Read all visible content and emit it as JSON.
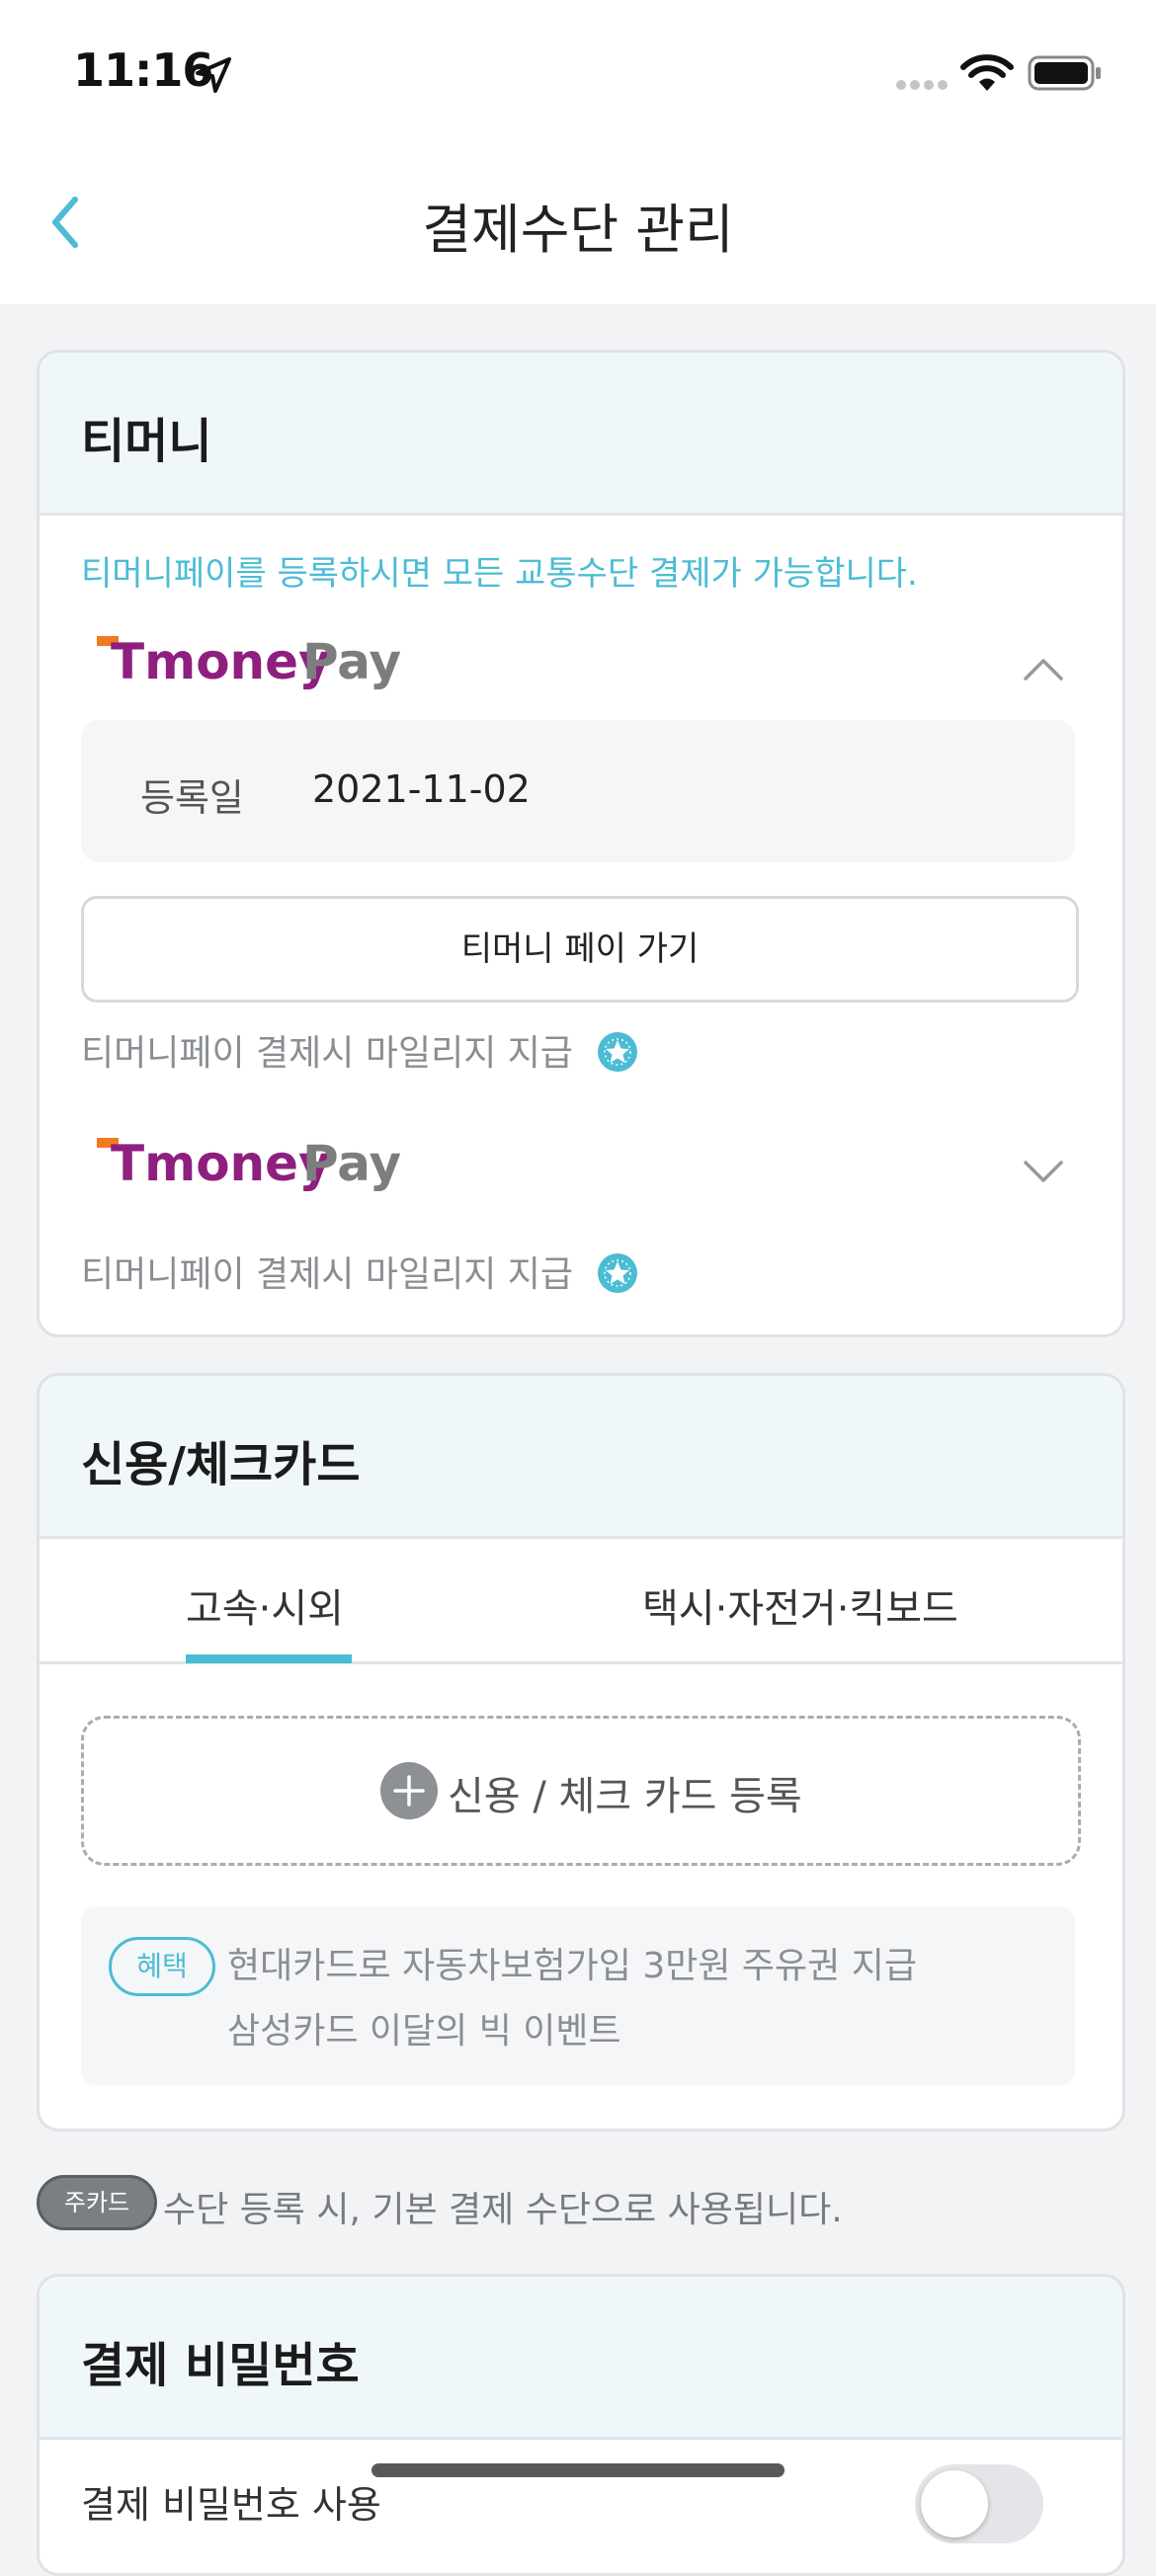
{
  "status_bar": {
    "time": "11:16",
    "icons": [
      "location-arrow-icon",
      "signal-dots-icon",
      "wifi-icon",
      "battery-icon"
    ]
  },
  "nav": {
    "title": "결제수단 관리",
    "back_icon": "chevron-left-icon"
  },
  "colors": {
    "accent": "#4bbcd4",
    "tmoney_purple": "#8e1f7e",
    "tmoney_orange": "#f07a1f",
    "tmoney_gray": "#7d7d7d"
  },
  "tmoney": {
    "title": "티머니",
    "info": "티머니페이를 등록하시면 모든 교통수단 결제가 가능합니다.",
    "logo_text_1": "Tmoney",
    "logo_text_2": "Pay",
    "registered_label": "등록일",
    "registered_date": "2021-11-02",
    "go_button": "티머니 페이 가기",
    "mileage_text_1": "티머니페이 결제시 마일리지 지급",
    "mileage_text_2": "티머니페이 결제시 마일리지 지급"
  },
  "credit": {
    "title": "신용/체크카드",
    "tabs": [
      {
        "label": "고속·시외",
        "selected": true
      },
      {
        "label": "택시·자전거·킥보드",
        "selected": false
      }
    ],
    "add_label": "신용 / 체크 카드 등록",
    "benefit_badge": "혜택",
    "benefits": [
      "현대카드로 자동차보험가입 3만원 주유권 지급",
      "삼성카드 이달의 빅 이벤트"
    ]
  },
  "main_card": {
    "badge": "주카드",
    "text": "수단 등록 시, 기본 결제 수단으로 사용됩니다."
  },
  "password": {
    "title": "결제 비밀번호",
    "row_label": "결제 비밀번호 사용",
    "toggle_on": false
  }
}
